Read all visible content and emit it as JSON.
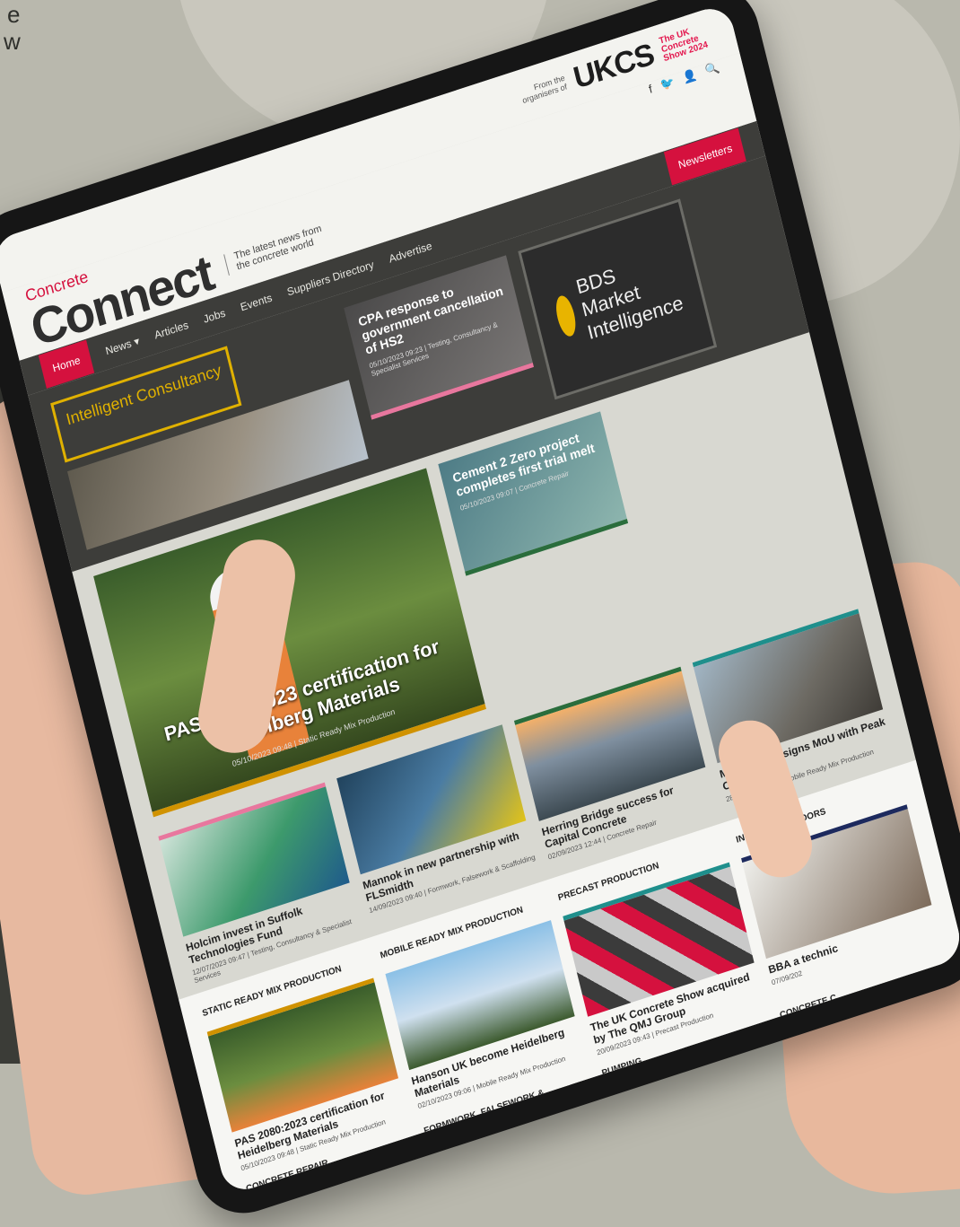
{
  "background_text": [
    "e",
    "w"
  ],
  "colors": {
    "brand_red": "#d5113e",
    "accent_gold": "#d09200",
    "nav_dark": "#3d3d3a"
  },
  "site": {
    "logo_top": "Concrete",
    "logo_main": "Connect",
    "tagline": "The latest news from the concrete world",
    "from_org": "From the organisers of",
    "ukcs": "UKCS",
    "ukcs_tag": "The UK Concrete Show 2024",
    "social_icons": [
      "facebook-icon",
      "twitter-icon",
      "user-icon",
      "search-icon"
    ]
  },
  "nav": {
    "items": [
      "Home",
      "News",
      "Articles",
      "Jobs",
      "Events",
      "Suppliers Directory",
      "Advertise",
      "Newsletters"
    ],
    "news_caret": "▾"
  },
  "banners": {
    "intelligent": "Intelligent Consultancy",
    "bds": "BDS Market Intelligence"
  },
  "featured": {
    "main": {
      "title": "PAS 2080:2023 certification for Heidelberg Materials",
      "meta": "05/10/2023 09:48 | Static Ready Mix Production"
    },
    "cpa": {
      "title": "CPA response to government cancellation of HS2",
      "meta": "05/10/2023 09:23 | Testing, Consultancy & Specialist Services"
    },
    "c2z": {
      "title": "Cement 2 Zero project completes first trial melt",
      "meta": "05/10/2023 09:07 | Concrete Repair"
    }
  },
  "row": [
    {
      "title": "Holcim invest in Suffolk Technologies Fund",
      "meta": "12/07/2023 09:47 | Testing, Consultancy & Specialist Services"
    },
    {
      "title": "Mannok in new partnership with FLSmidth",
      "meta": "14/09/2023 09:40 | Formwork, Falsework & Scaffolding"
    },
    {
      "title": "Herring Bridge success for Capital Concrete",
      "meta": "02/09/2023 12:44 | Concrete Repair"
    },
    {
      "title": "MNZ Cluster signs MoU with Peak Cluster",
      "meta": "28/09/2023 14:34 | Mobile Ready Mix Production"
    }
  ],
  "categories": [
    {
      "heading": "STATIC READY MIX PRODUCTION",
      "title": "PAS 2080:2023 certification for Heidelberg Materials",
      "meta": "05/10/2023 09:48 | Static Ready Mix Production"
    },
    {
      "heading": "MOBILE READY MIX PRODUCTION",
      "title": "Hanson UK become Heidelberg Materials",
      "meta": "02/10/2023 09:06 | Mobile Ready Mix Production"
    },
    {
      "heading": "PRECAST PRODUCTION",
      "title": "The UK Concrete Show acquired by The QMJ Group",
      "meta": "20/09/2023 09:43 | Precast Production"
    },
    {
      "heading": "INDUSTRIAL FLOORS",
      "title": "BBA a technic",
      "meta": "07/09/202"
    }
  ],
  "more_sections": [
    "CONCRETE REPAIR",
    "FORMWORK, FALSEWORK & SCAFFOLDING",
    "PUMPING",
    "CONCRETE C"
  ]
}
